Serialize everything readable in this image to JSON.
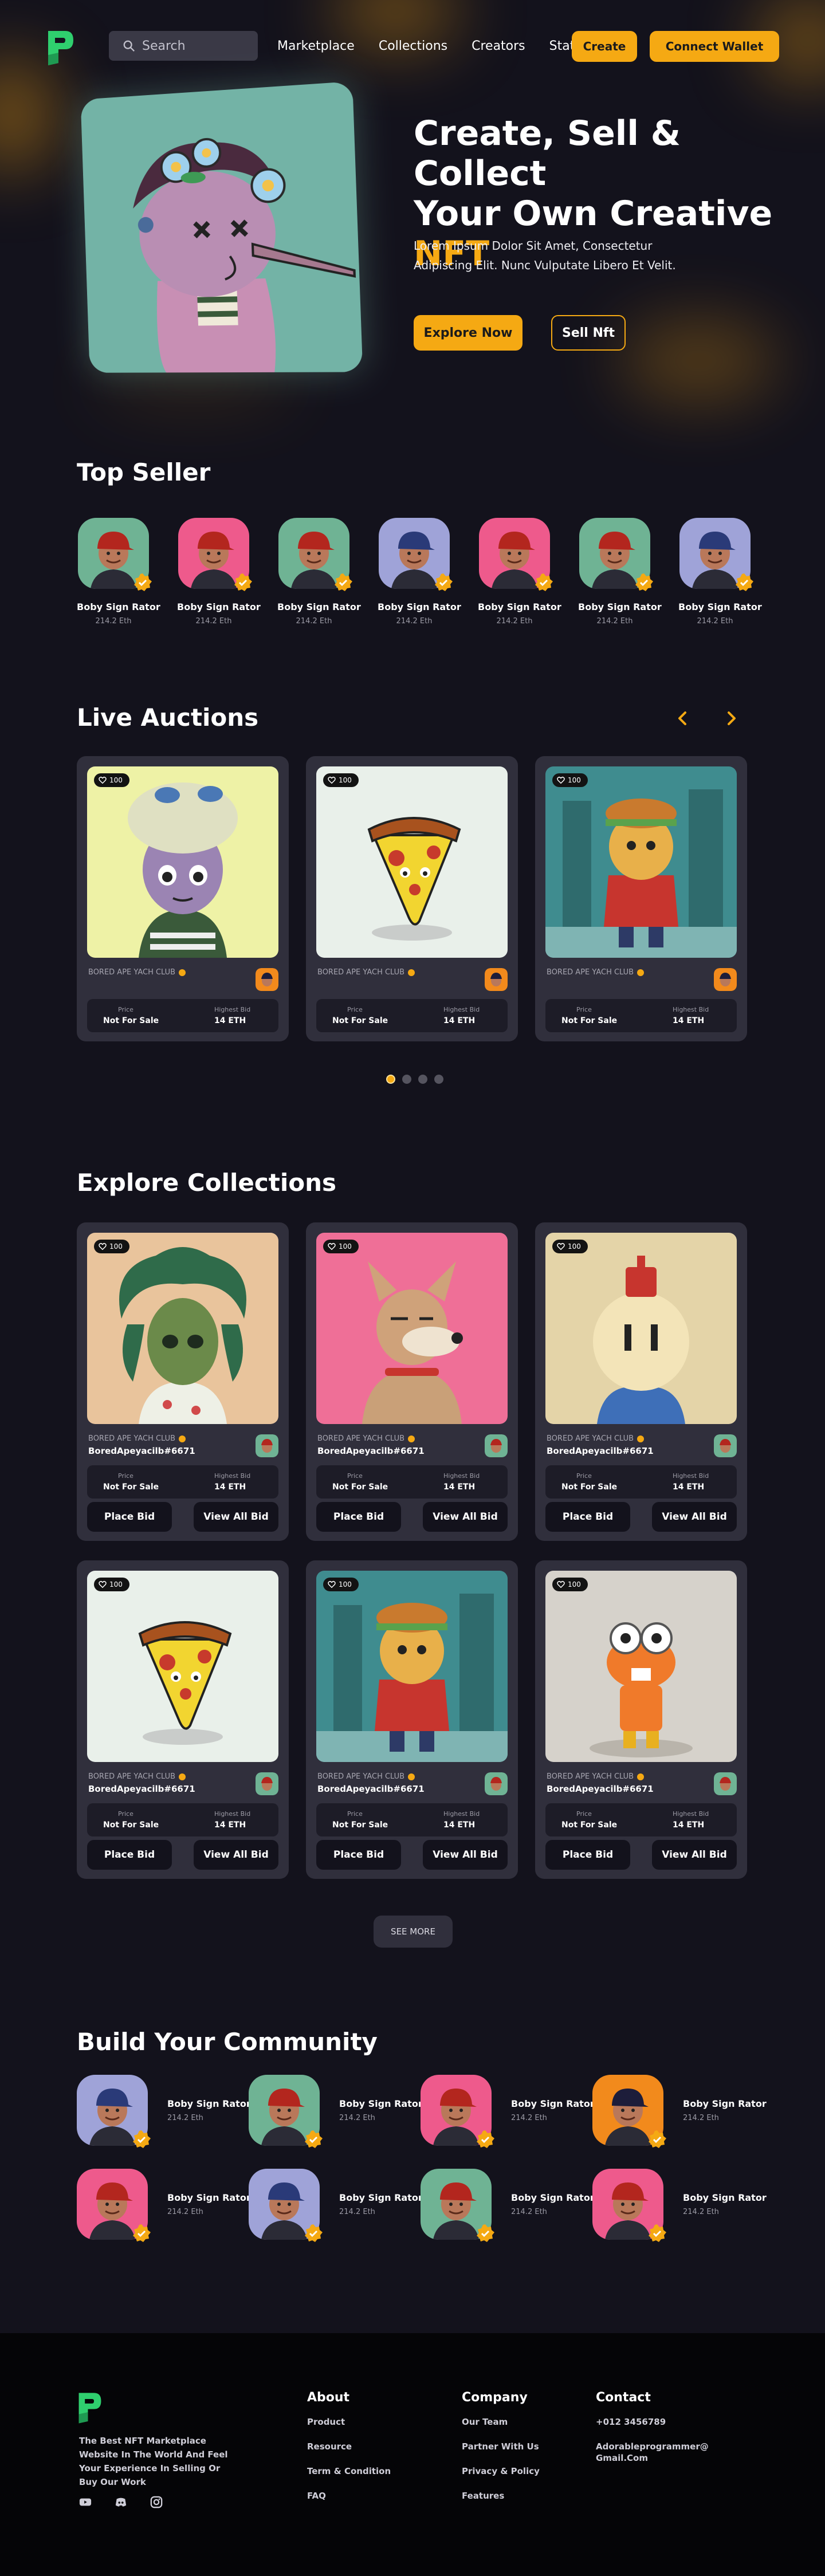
{
  "nav": {
    "search_placeholder": "Search",
    "links": [
      "Marketplace",
      "Collections",
      "Creators",
      "Stats"
    ],
    "create_label": "Create",
    "wallet_label": "Connect Wallet"
  },
  "hero": {
    "title_line1": "Create, Sell & Collect",
    "title_line2": "Your Own Creative",
    "title_accent": "NFT",
    "description": "Lorem Ipsum Dolor Sit Amet, Consectetur Adipiscing Elit. Nunc Vulputate Libero Et Velit.",
    "explore_label": "Explore Now",
    "sell_label": "Sell Nft"
  },
  "top_seller": {
    "title": "Top Seller",
    "sellers": [
      {
        "name": "Boby Sign Rator",
        "eth": "214.2 Eth",
        "bg": "#6fb394",
        "cap": "#b3261e"
      },
      {
        "name": "Boby Sign Rator",
        "eth": "214.2 Eth",
        "bg": "#ee5a8c",
        "cap": "#b3261e"
      },
      {
        "name": "Boby Sign Rator",
        "eth": "214.2 Eth",
        "bg": "#6fb394",
        "cap": "#b3261e"
      },
      {
        "name": "Boby Sign Rator",
        "eth": "214.2 Eth",
        "bg": "#9fa3d8",
        "cap": "#2a3a78"
      },
      {
        "name": "Boby Sign Rator",
        "eth": "214.2 Eth",
        "bg": "#ee5a8c",
        "cap": "#b3261e"
      },
      {
        "name": "Boby Sign Rator",
        "eth": "214.2 Eth",
        "bg": "#6fb394",
        "cap": "#b3261e"
      },
      {
        "name": "Boby Sign Rator",
        "eth": "214.2 Eth",
        "bg": "#9fa3d8",
        "cap": "#2a3a78"
      }
    ]
  },
  "auctions": {
    "title": "Live Auctions",
    "items": [
      {
        "likes": "100",
        "club": "BORED APE YACH CLUB",
        "name": "",
        "price_label": "Price",
        "price": "Not For Sale",
        "bid_label": "Highest Bid",
        "bid": "14  ETH",
        "bg": "#eef2a6",
        "art": "girl"
      },
      {
        "likes": "100",
        "club": "BORED APE YACH CLUB",
        "name": "",
        "price_label": "Price",
        "price": "Not For Sale",
        "bid_label": "Highest Bid",
        "bid": "14  ETH",
        "bg": "#e9f0ea",
        "art": "pizza"
      },
      {
        "likes": "100",
        "club": "BORED APE YACH CLUB",
        "name": "",
        "price_label": "Price",
        "price": "Not For Sale",
        "bid_label": "Highest Bid",
        "bid": "14  ETH",
        "bg": "#3f8c8f",
        "art": "burger"
      }
    ]
  },
  "collections": {
    "title": "Explore Collections",
    "items": [
      {
        "likes": "100",
        "club": "BORED APE YACH CLUB",
        "name": "BoredApeyacilb#6671",
        "price_label": "Price",
        "price": "Not For Sale",
        "bid_label": "Highest Bid",
        "bid": "14  ETH",
        "bid_btn": "Place Bid",
        "view_btn": "View All  Bid",
        "bg": "#e9c49c",
        "art": "leaf"
      },
      {
        "likes": "100",
        "club": "BORED APE YACH CLUB",
        "name": "BoredApeyacilb#6671",
        "price_label": "Price",
        "price": "Not For Sale",
        "bid_label": "Highest Bid",
        "bid": "14  ETH",
        "bid_btn": "Place Bid",
        "view_btn": "View All  Bid",
        "bg": "#ef6f97",
        "art": "dog"
      },
      {
        "likes": "100",
        "club": "BORED APE YACH CLUB",
        "name": "BoredApeyacilb#6671",
        "price_label": "Price",
        "price": "Not For Sale",
        "bid_label": "Highest Bid",
        "bid": "14  ETH",
        "bid_btn": "Place Bid",
        "view_btn": "View All  Bid",
        "bg": "#e4d4a8",
        "art": "fez"
      },
      {
        "likes": "100",
        "club": "BORED APE YACH CLUB",
        "name": "BoredApeyacilb#6671",
        "price_label": "Price",
        "price": "Not For Sale",
        "bid_label": "Highest Bid",
        "bid": "14  ETH",
        "bid_btn": "Place Bid",
        "view_btn": "View All  Bid",
        "bg": "#e9f0ea",
        "art": "pizza"
      },
      {
        "likes": "100",
        "club": "BORED APE YACH CLUB",
        "name": "BoredApeyacilb#6671",
        "price_label": "Price",
        "price": "Not For Sale",
        "bid_label": "Highest Bid",
        "bid": "14  ETH",
        "bid_btn": "Place Bid",
        "view_btn": "View All  Bid",
        "bg": "#3f8c8f",
        "art": "burger"
      },
      {
        "likes": "100",
        "club": "BORED APE YACH CLUB",
        "name": "BoredApeyacilb#6671",
        "price_label": "Price",
        "price": "Not For Sale",
        "bid_label": "Highest Bid",
        "bid": "14  ETH",
        "bid_btn": "Place Bid",
        "view_btn": "View All  Bid",
        "bg": "#d6d2cb",
        "art": "robot"
      }
    ],
    "see_more": "SEE MORE"
  },
  "community": {
    "title": "Build Your Community",
    "members": [
      {
        "name": "Boby Sign Rator",
        "eth": "214.2 Eth",
        "bg": "#9fa3d8",
        "cap": "#2a3a78"
      },
      {
        "name": "Boby Sign Rator",
        "eth": "214.2 Eth",
        "bg": "#6fb394",
        "cap": "#b3261e"
      },
      {
        "name": "Boby Sign Rator",
        "eth": "214.2 Eth",
        "bg": "#ee5a8c",
        "cap": "#b3261e"
      },
      {
        "name": "Boby Sign Rator",
        "eth": "214.2 Eth",
        "bg": "#f28a1c",
        "cap": "#1d1d3a"
      },
      {
        "name": "Boby Sign Rator",
        "eth": "214.2 Eth",
        "bg": "#ee5a8c",
        "cap": "#b3261e"
      },
      {
        "name": "Boby Sign Rator",
        "eth": "214.2 Eth",
        "bg": "#9fa3d8",
        "cap": "#2a3a78"
      },
      {
        "name": "Boby Sign Rator",
        "eth": "214.2 Eth",
        "bg": "#6fb394",
        "cap": "#b3261e"
      },
      {
        "name": "Boby Sign Rator",
        "eth": "214.2 Eth",
        "bg": "#ee5a8c",
        "cap": "#b3261e"
      }
    ]
  },
  "footer": {
    "tagline": "The Best NFT Marketplace Website In The World And Feel Your Experience In Selling Or Buy Our Work",
    "socials": [
      "youtube-icon",
      "discord-icon",
      "instagram-icon"
    ],
    "about": {
      "title": "About",
      "items": [
        "Product",
        "Resource",
        "Term & Condition",
        "FAQ"
      ]
    },
    "company": {
      "title": "Company",
      "items": [
        "Our Team",
        "Partner With Us",
        "Privacy & Policy",
        "Features"
      ]
    },
    "contact": {
      "title": "Contact",
      "phone": "+012 3456789",
      "email": "Adorableprogrammer@Gmail.Com"
    }
  },
  "colors": {
    "accent": "#f5a913",
    "background": "#13121c",
    "card": "#302f3c",
    "footer": "#050507",
    "brand_green": "#2fcf6e"
  }
}
